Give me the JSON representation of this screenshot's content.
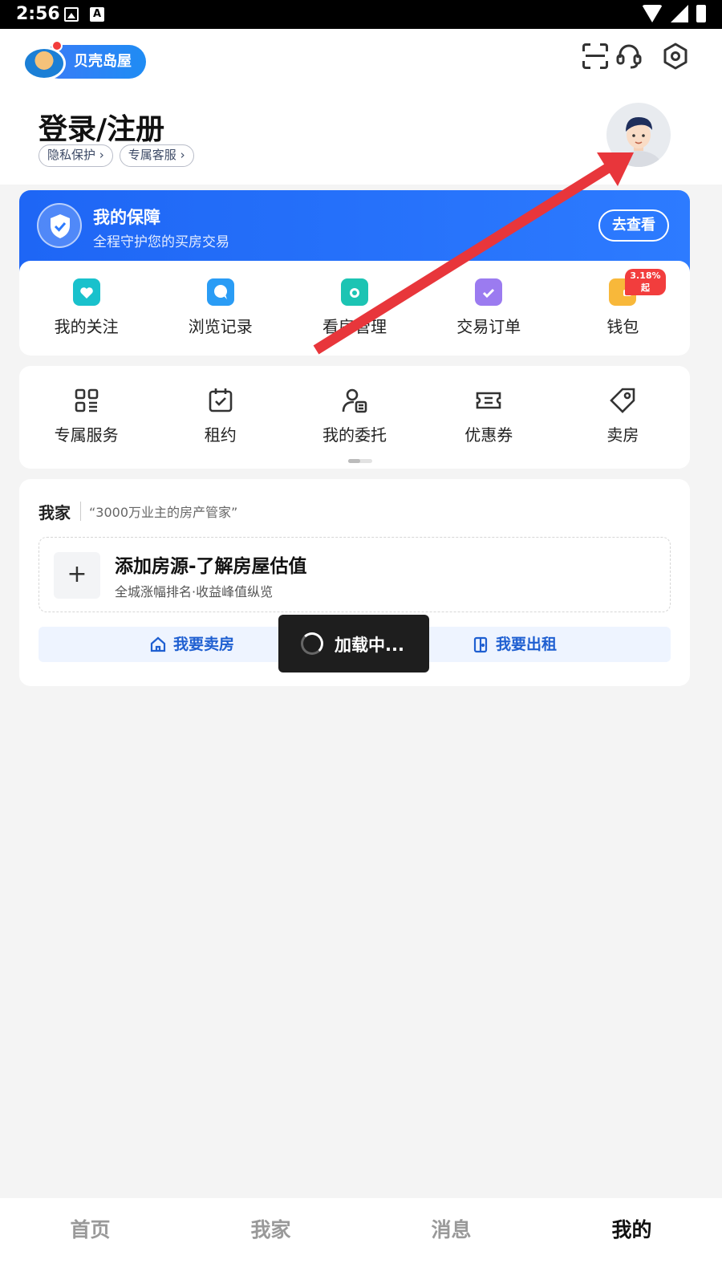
{
  "status_bar": {
    "time": "2:56"
  },
  "app": {
    "logo_text": "贝壳岛屋"
  },
  "header": {
    "login_title": "登录/注册",
    "chips": [
      "隐私保护",
      "专属客服"
    ]
  },
  "guarantee": {
    "title": "我的保障",
    "subtitle": "全程守护您的买房交易",
    "button": "去查看"
  },
  "quick_items": [
    {
      "label": "我的关注",
      "icon": "heart-house-icon",
      "color": "#19c1cc"
    },
    {
      "label": "浏览记录",
      "icon": "chat-bubble-icon",
      "color": "#2a9cf5"
    },
    {
      "label": "看房管理",
      "icon": "camera-icon",
      "color": "#1cc4b3"
    },
    {
      "label": "交易订单",
      "icon": "clipboard-check-icon",
      "color": "#9b7bf0"
    },
    {
      "label": "钱包",
      "icon": "wallet-icon",
      "color": "#f8b83a",
      "badge": "3.18%起"
    }
  ],
  "service_items": [
    {
      "label": "专属服务",
      "icon": "grid-apps-icon"
    },
    {
      "label": "租约",
      "icon": "calendar-check-icon"
    },
    {
      "label": "我的委托",
      "icon": "person-document-icon"
    },
    {
      "label": "优惠券",
      "icon": "ticket-icon"
    },
    {
      "label": "卖房",
      "icon": "price-tag-icon"
    }
  ],
  "my_home": {
    "title": "我家",
    "slogan": "“3000万业主的房产管家”",
    "add_title": "添加房源-了解房屋估值",
    "add_sub": "全城涨幅排名·收益峰值纵览",
    "sell_label": "我要卖房",
    "rent_label": "我要出租"
  },
  "toast": {
    "text": "加载中..."
  },
  "tabs": [
    {
      "label": "首页",
      "active": false
    },
    {
      "label": "我家",
      "active": false
    },
    {
      "label": "消息",
      "active": false
    },
    {
      "label": "我的",
      "active": true
    }
  ],
  "colors": {
    "accent": "#2d7bff",
    "badge": "#f23d3d",
    "annotation_arrow": "#e8363b"
  }
}
